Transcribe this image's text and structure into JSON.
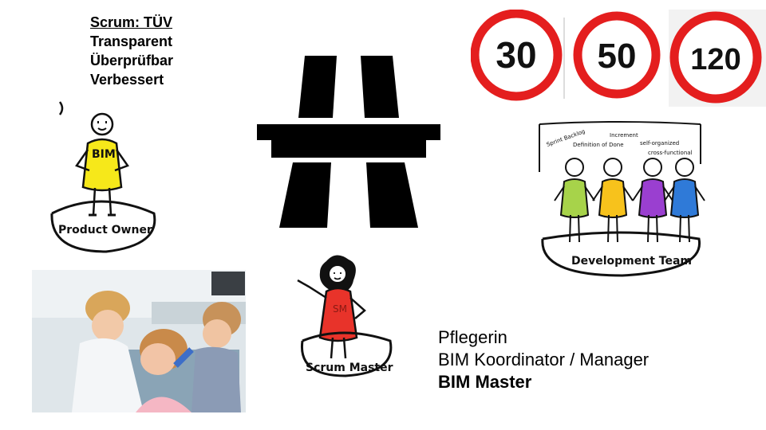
{
  "scrum_tuev": {
    "heading": "Scrum: TÜV",
    "items": [
      "Transparent",
      "Überprüfbar",
      "Verbessert"
    ]
  },
  "speed_signs": [
    "30",
    "50",
    "120"
  ],
  "figures": {
    "product_owner": {
      "label": "Product Owner",
      "shirt_text": "BIM",
      "shirt_color": "#f6e81a"
    },
    "scrum_master": {
      "label": "Scrum Master",
      "shirt_text": "SM",
      "shirt_color": "#e8332a"
    },
    "development_team": {
      "label": "Development Team",
      "words": [
        "Sprint Backlog",
        "Increment",
        "Definition of Done",
        "self-organized",
        "cross-functional"
      ],
      "shirt_colors": [
        "#a7d34a",
        "#f7c21c",
        "#9a3fd0",
        "#2f7ad8"
      ]
    }
  },
  "roles": {
    "line1": "Pflegerin",
    "line2": "BIM Koordinator / Manager",
    "line3": "BIM Master"
  },
  "icons": [
    "motorway-icon",
    "dental-play-photo"
  ]
}
